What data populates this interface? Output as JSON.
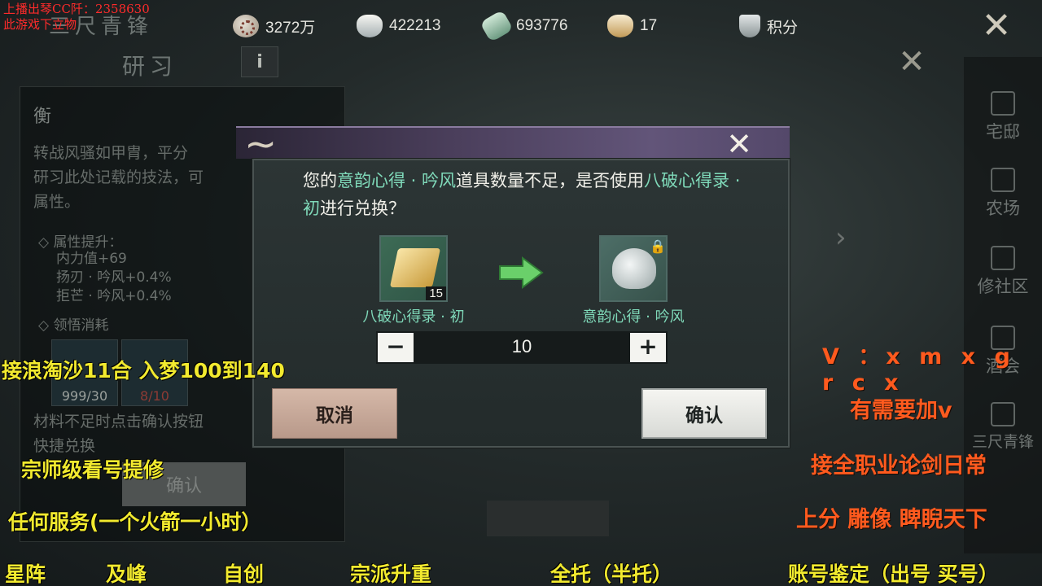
{
  "resources": [
    {
      "icon": "film-reel-icon",
      "value": "3272万"
    },
    {
      "icon": "silver-ingot-icon",
      "value": "422213"
    },
    {
      "icon": "jade-icon",
      "value": "693776"
    },
    {
      "icon": "gold-ingot-icon",
      "value": "17"
    },
    {
      "icon": "shield-icon",
      "value": "积分"
    }
  ],
  "background": {
    "title": "三尺青锋",
    "subtitle": "研习",
    "info_label": "i",
    "panel": {
      "heading": "衡",
      "desc_lines": [
        "转战风骚如甲胄，平分",
        "研习此处记载的技法，可",
        "属性。"
      ],
      "attr_title": "属性提升：",
      "attr_lines": [
        "内力值+69",
        "扬刃 · 吟风+0.4%",
        "拒芒 · 吟风+0.4%"
      ],
      "cost_title": "领悟消耗",
      "slot1_count": "999/30",
      "slot2_count": "8/10",
      "hint_lines": [
        "材料不足时点击确认按钮",
        "快捷兑换"
      ],
      "confirm_label": "确认"
    },
    "rail": [
      {
        "icon": "house-icon",
        "label": "宅邸"
      },
      {
        "icon": "plant-icon",
        "label": "农场"
      },
      {
        "icon": "pavilion-icon",
        "label": "修社区"
      },
      {
        "icon": "wine-icon",
        "label": "酒会"
      },
      {
        "icon": "sword-icon",
        "label": "三尺青锋"
      }
    ]
  },
  "dialog": {
    "message_parts": [
      {
        "text": "您的",
        "hl": false
      },
      {
        "text": "意韵心得 · 吟风",
        "hl": true
      },
      {
        "text": "道具数量不足，是否使用",
        "hl": false
      },
      {
        "text": "八破心得录 · 初",
        "hl": true
      },
      {
        "text": "进行兑换？",
        "hl": false
      }
    ],
    "source_item": {
      "name": "八破心得录 · 初",
      "count": "15"
    },
    "target_item": {
      "name": "意韵心得 · 吟风",
      "locked": true
    },
    "quantity": "10",
    "minus_label": "−",
    "plus_label": "+",
    "cancel_label": "取消",
    "confirm_label": "确认"
  },
  "overlay": {
    "red_lines": [
      "上播出琴CC阡：2358630",
      "此游戏下立物"
    ],
    "yellow": [
      "接浪淘沙11合  入梦100到140",
      "宗师级看号提修",
      "任何服务(一个火箭一小时）"
    ],
    "bottom": [
      "星阵",
      "及峰",
      "自创",
      "宗派升重",
      "全托（半托）",
      "账号鉴定（出号 买号）"
    ],
    "orange": [
      "V ：x m x g r c x",
      "有需要加v",
      "接全职业论剑日常",
      "上分  雕像  睥睨天下"
    ]
  },
  "colors": {
    "highlight": "#7fd9b9",
    "ad_yellow": "#f2ea2f",
    "ad_orange": "#ff5a1e",
    "ad_red": "#ff2b2b"
  }
}
